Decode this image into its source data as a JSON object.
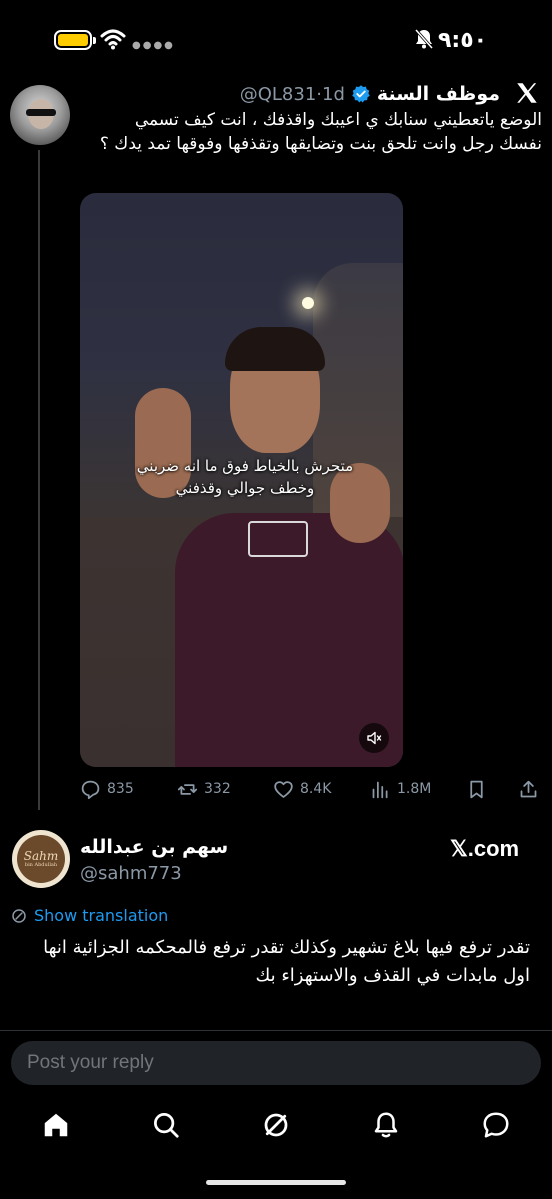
{
  "status_bar": {
    "time": "٩:٥٠",
    "battery_color": "#ffcc00"
  },
  "tweet": {
    "author_name": "موظف السنة",
    "handle": "@QL831",
    "separator": "·",
    "age": "1d",
    "text": "الوضع ياتعطيني سنابك ي اعيبك واقذفك ، انت كيف تسمي نفسك رجل وانت تلحق بنت وتضايقها وتقذفها وفوقها تمد يدك ؟",
    "video_caption_line1": "متحرش بالخياط فوق ما انه ضربني",
    "video_caption_line2": "وخطف جوالي وقذفني",
    "stats": {
      "replies": "835",
      "reposts": "332",
      "likes": "8.4K",
      "views": "1.8M"
    }
  },
  "reply": {
    "author_name": "سهم بن عبدالله",
    "handle": "@sahm773",
    "avatar_text": "Sahm",
    "avatar_subtext": "bin Abdullah",
    "source_badge": "𝕏.com",
    "translate_label": "Show translation",
    "text": "تقدر ترفع فيها بلاغ تشهير وكذلك تقدر ترفع فالمحكمه الجزائية انها اول مابدات في القذف والاستهزاء بك"
  },
  "composer": {
    "placeholder": "Post your reply"
  },
  "colors": {
    "accent": "#1d9bf0",
    "verified": "#1d9bf0",
    "muted": "#8b98a5"
  },
  "nav_icons": [
    "home-icon",
    "search-icon",
    "grok-icon",
    "notifications-icon",
    "messages-icon"
  ]
}
